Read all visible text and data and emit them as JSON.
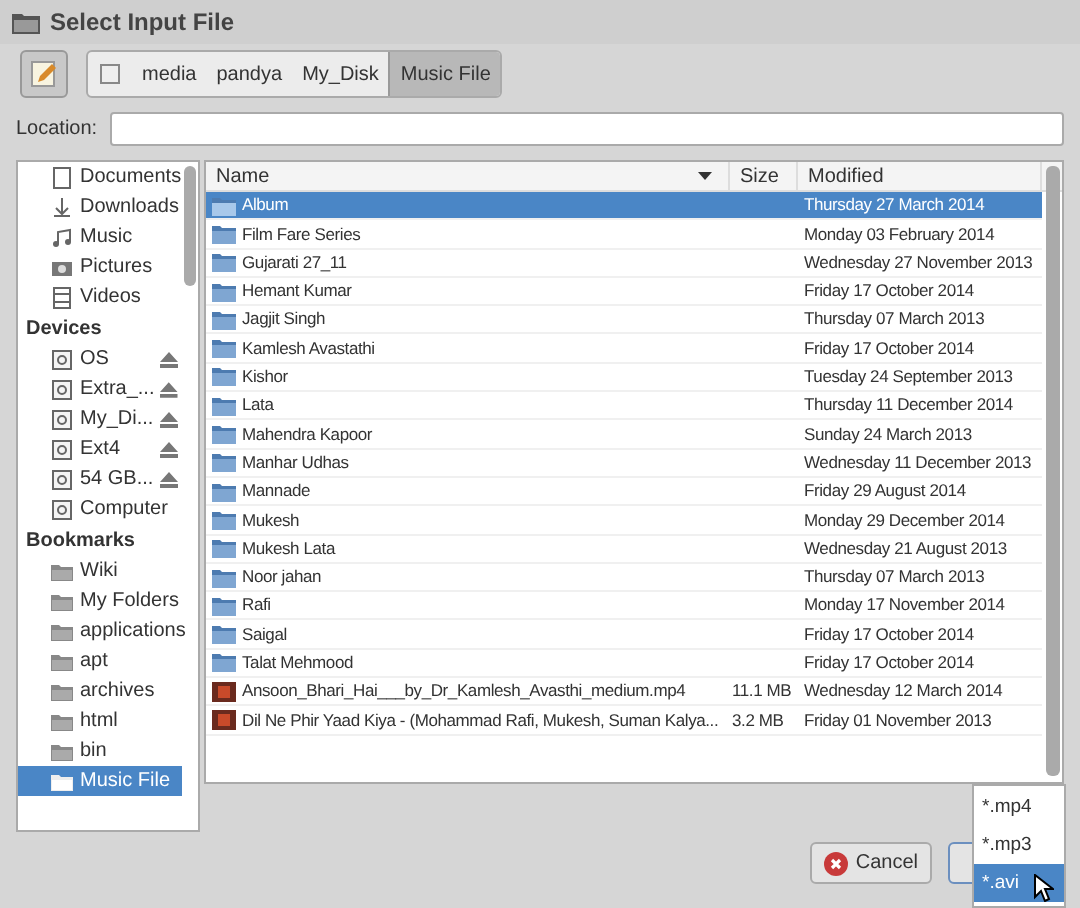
{
  "window": {
    "title": "Select Input File"
  },
  "path_bar": [
    {
      "label": "media",
      "selected": false
    },
    {
      "label": "pandya",
      "selected": false
    },
    {
      "label": "My_Disk",
      "selected": false
    },
    {
      "label": "Music File",
      "selected": true
    }
  ],
  "location": {
    "label": "Location:"
  },
  "sidebar": [
    {
      "items": [
        {
          "label": "Documents",
          "selected": false
        },
        {
          "label": "Downloads",
          "selected": false
        },
        {
          "label": "Music",
          "selected": false
        },
        {
          "label": "Pictures",
          "selected": false
        },
        {
          "label": "Videos",
          "selected": false
        }
      ]
    },
    {
      "heading": "Devices",
      "items": [
        {
          "label": "OS",
          "eject": true,
          "selected": false
        },
        {
          "label": "Extra_...",
          "eject": true,
          "selected": false
        },
        {
          "label": "My_Di...",
          "eject": true,
          "selected": false
        },
        {
          "label": "Ext4",
          "eject": true,
          "selected": false
        },
        {
          "label": "54 GB...",
          "eject": true,
          "selected": false
        },
        {
          "label": "Computer",
          "eject": false,
          "selected": false
        }
      ]
    },
    {
      "heading": "Bookmarks",
      "items": [
        {
          "label": "Wiki",
          "selected": false
        },
        {
          "label": "My Folders",
          "selected": false
        },
        {
          "label": "applications",
          "selected": false
        },
        {
          "label": "apt",
          "selected": false
        },
        {
          "label": "archives",
          "selected": false
        },
        {
          "label": "html",
          "selected": false
        },
        {
          "label": "bin",
          "selected": false
        },
        {
          "label": "Music File",
          "selected": true
        }
      ]
    }
  ],
  "file_list": {
    "columns": [
      {
        "label": "Name",
        "sorted": true
      },
      {
        "label": "Size",
        "sorted": false
      },
      {
        "label": "Modified",
        "sorted": false
      }
    ],
    "rows": [
      {
        "kind": "folder",
        "name": "Album",
        "modified": "Thursday 27 March 2014",
        "selected": true
      },
      {
        "kind": "folder",
        "name": "Film Fare Series",
        "modified": "Monday 03 February 2014",
        "selected": false
      },
      {
        "kind": "folder",
        "name": "Gujarati 27_11",
        "modified": "Wednesday 27 November 2013",
        "selected": false
      },
      {
        "kind": "folder",
        "name": "Hemant Kumar",
        "modified": "Friday 17 October 2014",
        "selected": false
      },
      {
        "kind": "folder",
        "name": "Jagjit Singh",
        "modified": "Thursday 07 March 2013",
        "selected": false
      },
      {
        "kind": "folder",
        "name": "Kamlesh Avastathi",
        "modified": "Friday 17 October 2014",
        "selected": false
      },
      {
        "kind": "folder",
        "name": "Kishor",
        "modified": "Tuesday 24 September 2013",
        "selected": false
      },
      {
        "kind": "folder",
        "name": "Lata",
        "modified": "Thursday 11 December 2014",
        "selected": false
      },
      {
        "kind": "folder",
        "name": "Mahendra Kapoor",
        "modified": "Sunday 24 March 2013",
        "selected": false
      },
      {
        "kind": "folder",
        "name": "Manhar Udhas",
        "modified": "Wednesday 11 December 2013",
        "selected": false
      },
      {
        "kind": "folder",
        "name": "Mannade",
        "modified": "Friday 29 August 2014",
        "selected": false
      },
      {
        "kind": "folder",
        "name": "Mukesh",
        "modified": "Monday 29 December 2014",
        "selected": false
      },
      {
        "kind": "folder",
        "name": "Mukesh Lata",
        "modified": "Wednesday 21 August 2013",
        "selected": false
      },
      {
        "kind": "folder",
        "name": "Noor jahan",
        "modified": "Thursday 07 March 2013",
        "selected": false
      },
      {
        "kind": "folder",
        "name": "Rafi",
        "modified": "Monday 17 November 2014",
        "selected": false
      },
      {
        "kind": "folder",
        "name": "Saigal",
        "modified": "Friday 17 October 2014",
        "selected": false
      },
      {
        "kind": "folder",
        "name": "Talat Mehmood",
        "modified": "Friday 17 October 2014",
        "selected": false
      },
      {
        "kind": "video",
        "name": "Ansoon_Bhari_Hai___by_Dr_Kamlesh_Avasthi_medium.mp4",
        "size": "11.1 MB",
        "modified": "Wednesday 12 March 2014",
        "selected": false
      },
      {
        "kind": "video",
        "name": "Dil Ne Phir Yaad Kiya - (Mohammad Rafi, Mukesh, Suman Kalya...",
        "size": "3.2 MB",
        "modified": "Friday 01 November 2013",
        "selected": false
      }
    ]
  },
  "cancel_button": {
    "label": "Cancel"
  },
  "filter_menu": [
    {
      "label": "*.mp4",
      "selected": false
    },
    {
      "label": "*.mp3",
      "selected": false
    },
    {
      "label": "*.avi",
      "selected": true
    }
  ]
}
